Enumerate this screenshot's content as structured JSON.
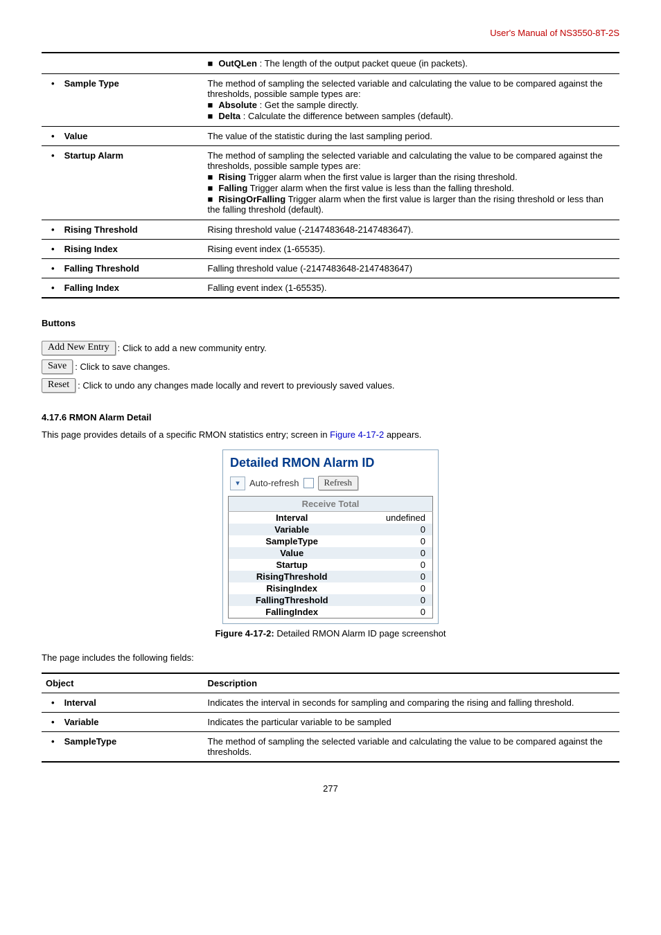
{
  "header_right": "User's Manual of NS3550-8T-2S",
  "table1": {
    "rows": [
      {
        "label": "",
        "content_items": [
          {
            "type": "sq_bold_text",
            "bold": "OutQLen",
            "text": ": The length of the output packet queue (in packets)."
          }
        ]
      },
      {
        "label_bullet": true,
        "label_text": "Sample Type",
        "content_lines": [
          "The method of sampling the selected variable and calculating the value to be compared against the thresholds, possible sample types are:"
        ],
        "content_items": [
          {
            "type": "sq_bold_text",
            "bold": "Absolute",
            "text": ": Get the sample directly."
          },
          {
            "type": "sq_bold_text",
            "bold": "Delta",
            "text": ": Calculate the difference between samples (default)."
          }
        ]
      },
      {
        "label_bullet": true,
        "label_text": "Value",
        "content_lines": [
          "The value of the statistic during the last sampling period."
        ]
      },
      {
        "label_bullet": true,
        "label_text": "Startup Alarm",
        "content_lines": [
          "The method of sampling the selected variable and calculating the value to be compared against the thresholds, possible sample types are:"
        ],
        "content_items": [
          {
            "type": "sq_bold_text",
            "bold": "Rising",
            "text": "Trigger alarm when the first value is larger than the rising threshold."
          },
          {
            "type": "sq_bold_text",
            "bold": "Falling",
            "text": "Trigger alarm when the first value is less than the falling threshold."
          },
          {
            "type": "sq_bold_text",
            "bold": "RisingOrFalling",
            "text": "Trigger alarm when the first value is larger than the rising threshold or less than the falling threshold (default)."
          }
        ]
      },
      {
        "label_bullet": true,
        "label_text": "Rising Threshold",
        "content_lines": [
          "Rising threshold value (-2147483648-2147483647)."
        ]
      },
      {
        "label_bullet": true,
        "label_text": "Rising Index",
        "content_lines": [
          "Rising event index (1-65535)."
        ]
      },
      {
        "label_bullet": true,
        "label_text": "Falling Threshold",
        "content_lines": [
          "Falling threshold value (-2147483648-2147483647)"
        ]
      },
      {
        "label_bullet": true,
        "label_text": "Falling Index",
        "content_lines": [
          "Falling event index (1-65535)."
        ]
      }
    ]
  },
  "buttons_heading": "Buttons",
  "buttons": [
    {
      "label": "Add New Entry",
      "desc": ": Click to add a new community entry."
    },
    {
      "label": "Save",
      "desc": ": Click to save changes."
    },
    {
      "label": "Reset",
      "desc": ": Click to undo any changes made locally and revert to previously saved values."
    }
  ],
  "section_heading": "4.17.6 RMON Alarm Detail",
  "paragraph_pre": "This page provides details of a specific RMON statistics entry; screen in ",
  "figure_ref": "Figure 4-17-2",
  "paragraph_post": " appears.",
  "panel": {
    "title": "Detailed RMON Alarm  ID",
    "auto_refresh_label": "Auto-refresh",
    "refresh_label": "Refresh",
    "section_header": "Receive Total",
    "rows": [
      {
        "label": "Interval",
        "value": "undefined",
        "alt": false
      },
      {
        "label": "Variable",
        "value": "0",
        "alt": true
      },
      {
        "label": "SampleType",
        "value": "0",
        "alt": false
      },
      {
        "label": "Value",
        "value": "0",
        "alt": true
      },
      {
        "label": "Startup",
        "value": "0",
        "alt": false
      },
      {
        "label": "RisingThreshold",
        "value": "0",
        "alt": true
      },
      {
        "label": "RisingIndex",
        "value": "0",
        "alt": false
      },
      {
        "label": "FallingThreshold",
        "value": "0",
        "alt": true
      },
      {
        "label": "FallingIndex",
        "value": "0",
        "alt": false
      }
    ]
  },
  "fig_caption_bold": "Figure 4-17-2:",
  "fig_caption_text": " Detailed RMON Alarm ID page screenshot",
  "table2_intro": "The page includes the following fields:",
  "table2": {
    "head_obj": "Object",
    "head_desc": "Description",
    "rows": [
      {
        "label": "Interval",
        "desc": "Indicates the interval in seconds for sampling and comparing the rising and falling threshold."
      },
      {
        "label": "Variable",
        "desc": "Indicates the particular variable to be sampled"
      },
      {
        "label": "SampleType",
        "desc": "The method of sampling the selected variable and calculating the value to be compared against the thresholds."
      }
    ]
  },
  "page_number": "277"
}
